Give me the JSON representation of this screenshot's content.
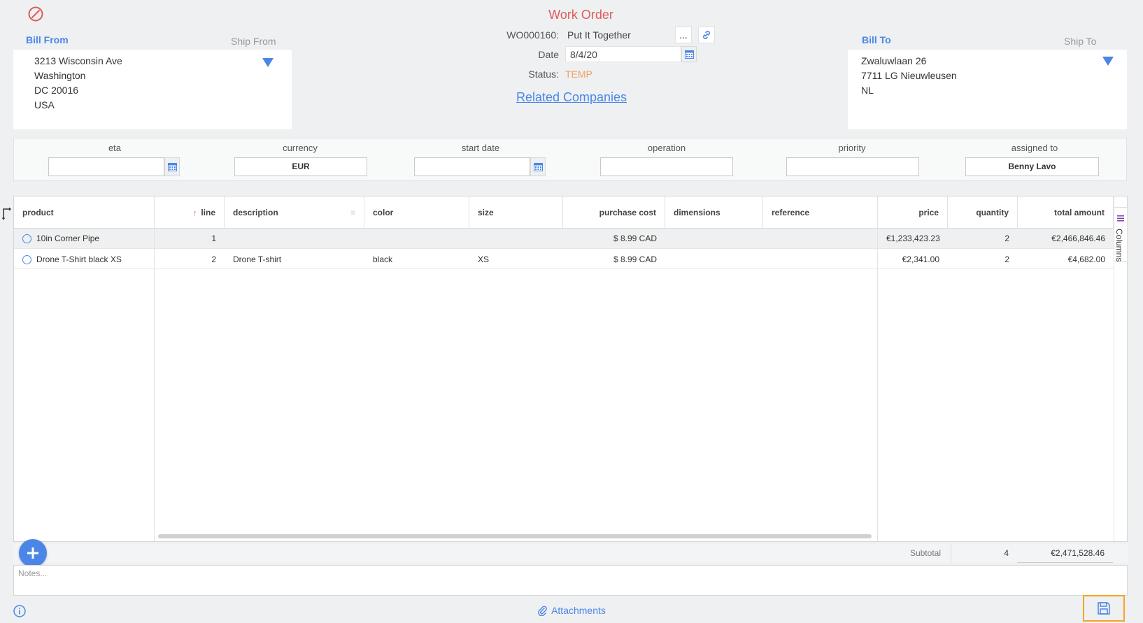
{
  "title": "Work Order",
  "bill_from": {
    "label": "Bill From",
    "ship_label": "Ship From",
    "lines": [
      "3213 Wisconsin Ave",
      "Washington",
      "DC 20016",
      "USA"
    ]
  },
  "bill_to": {
    "label": "Bill To",
    "ship_label": "Ship To",
    "lines": [
      "Zwaluwlaan 26",
      "7711 LG Nieuwleusen",
      "NL"
    ]
  },
  "header": {
    "order_id": "WO000160:",
    "order_name": "Put It Together",
    "more_label": "...",
    "date_label": "Date",
    "date_value": "8/4/20",
    "status_label": "Status:",
    "status_value": "TEMP",
    "status_color": "#f0a35e",
    "related_companies": "Related Companies"
  },
  "fields": {
    "eta": {
      "label": "eta",
      "value": ""
    },
    "currency": {
      "label": "currency",
      "value": "EUR"
    },
    "start_date": {
      "label": "start date",
      "value": ""
    },
    "operation": {
      "label": "operation",
      "value": ""
    },
    "priority": {
      "label": "priority",
      "value": ""
    },
    "assigned_to": {
      "label": "assigned to",
      "value": "Benny Lavo"
    }
  },
  "grid": {
    "columns": [
      "product",
      "line",
      "description",
      "color",
      "size",
      "purchase cost",
      "dimensions",
      "reference",
      "price",
      "quantity",
      "total amount"
    ],
    "sort_indicator": "↑",
    "rows": [
      {
        "product": "10in Corner Pipe",
        "line": "1",
        "description": "",
        "color": "",
        "size": "",
        "purchase_cost": "$ 8.99 CAD",
        "dimensions": "",
        "reference": "",
        "price": "€1,233,423.23",
        "quantity": "2",
        "total": "€2,466,846.46"
      },
      {
        "product": "Drone T-Shirt black XS",
        "line": "2",
        "description": "Drone T-shirt",
        "color": "black",
        "size": "XS",
        "purchase_cost": "$ 8.99 CAD",
        "dimensions": "",
        "reference": "",
        "price": "€2,341.00",
        "quantity": "2",
        "total": "€4,682.00"
      }
    ],
    "columns_tab": "Columns"
  },
  "subtotal": {
    "label": "Subtotal",
    "quantity": "4",
    "amount": "€2,471,528.46"
  },
  "notes_placeholder": "Notes...",
  "attachments_label": "Attachments",
  "icons": {
    "cancel": "cancel-icon",
    "link": "link-icon",
    "calendar": "calendar-icon",
    "dropdown": "caret-down-icon",
    "add": "plus-icon",
    "info": "info-icon",
    "paperclip": "paperclip-icon",
    "save": "save-icon",
    "columns": "columns-icon",
    "expand": "expand-arrow-icon"
  },
  "colors": {
    "accent": "#4a86e8",
    "title": "#e05a5a",
    "highlight": "#f5a623"
  }
}
